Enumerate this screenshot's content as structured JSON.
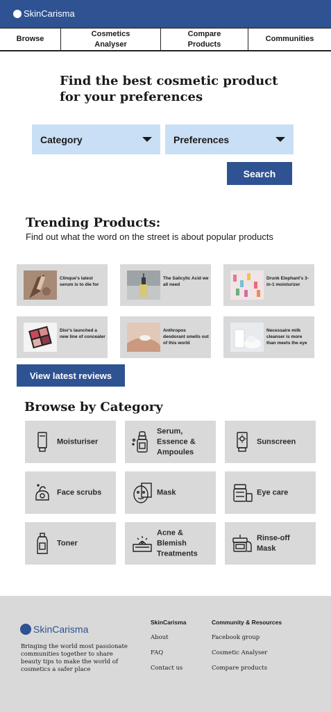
{
  "app": {
    "brand": "SkinCarisma",
    "accent": "#2e5292",
    "panel_color": "#d9d9d9",
    "select_color": "#c9dff5"
  },
  "nav": {
    "tabs": [
      {
        "label": "Browse"
      },
      {
        "label": "Cosmetics\nAnalyser"
      },
      {
        "label": "Compare\nProducts"
      },
      {
        "label": "Communities"
      }
    ]
  },
  "hero": {
    "title": "Find the best cosmetic product\nfor your preferences",
    "category_select": "Category",
    "preferences_select": "Preferences",
    "search_label": "Search"
  },
  "trending": {
    "title": "Trending Products:",
    "subtitle": "Find out what the word on the street is about popular products",
    "items": [
      {
        "text": "Clinque's latest serum is to die for",
        "icon": "dropper-bottle-photo"
      },
      {
        "text": "The Salicylic Acid we all need",
        "icon": "serum-bottle-photo"
      },
      {
        "text": "Drunk Elephant's 3-in-1 moisturizer",
        "icon": "colorful-bottles-photo"
      },
      {
        "text": "Dior's launched a new line of concealer",
        "icon": "makeup-palette-photo"
      },
      {
        "text": "Anthropos deodorant smells out of this world",
        "icon": "cream-hand-photo"
      },
      {
        "text": "Necessaire milk cleanser is more than meets the eye",
        "icon": "milk-cleanser-photo"
      }
    ],
    "view_reviews_label": "View latest reviews"
  },
  "categories": {
    "title": "Browse by Category",
    "items": [
      {
        "label": "Moisturiser",
        "icon": "tube-icon"
      },
      {
        "label": "Serum,\nEssence &\nAmpoules",
        "icon": "dropper-icon"
      },
      {
        "label": "Sunscreen",
        "icon": "sunscreen-icon"
      },
      {
        "label": "Face scrubs",
        "icon": "scrub-icon"
      },
      {
        "label": "Mask",
        "icon": "face-mask-icon"
      },
      {
        "label": "Eye care",
        "icon": "eye-cream-jar-icon"
      },
      {
        "label": "Toner",
        "icon": "toner-bottle-icon"
      },
      {
        "label": "Acne &\nBlemish\nTreatments",
        "icon": "acne-skin-icon"
      },
      {
        "label": "Rinse-off\nMask",
        "icon": "rinse-mask-jar-icon"
      }
    ]
  },
  "footer": {
    "brand": "SkinCarisma",
    "tagline": "Bringing the world most passionate communities together to share beauty tips to make the world of cosmetics a safer place",
    "col1": {
      "heading": "SkinCarisma",
      "links": [
        "About",
        "FAQ",
        "Contact us"
      ]
    },
    "col2": {
      "heading": "Community & Resources",
      "links": [
        "Facebook group",
        "Cosmetic Analyser",
        "Compare products"
      ]
    }
  }
}
